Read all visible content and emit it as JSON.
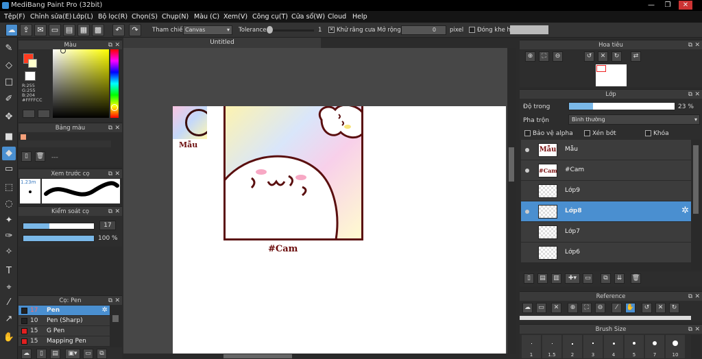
{
  "app": {
    "title": "MediBang Paint Pro (32bit)"
  },
  "window": {
    "min": "—",
    "max": "❐",
    "close": "✕"
  },
  "menu": [
    "Tệp(F)",
    "Chỉnh sửa(E)",
    "Lớp(L)",
    "Bộ lọc(R)",
    "Chọn(S)",
    "Chụp(N)",
    "Màu (C)",
    "Xem(V)",
    "Công cụ(T)",
    "Cửa sổ(W)",
    "Cloud",
    "Help"
  ],
  "toolbar": {
    "ref_label": "Tham chiếu",
    "ref_value": "Canvas",
    "tolerance_label": "Tolerance",
    "tolerance_value": "1",
    "antialias_label": "Khử răng cưa",
    "expand_label": "Mở rộng",
    "expand_value": "0",
    "expand_unit": "pixel",
    "gap_label": "Đóng khe hở"
  },
  "document": {
    "tab": "Untitled"
  },
  "color_panel": {
    "title": "Màu",
    "r": "R:255",
    "g": "G:255",
    "b": "B:204",
    "hex": "#FFFFCC",
    "fg_color": "#ff3b1f",
    "bg_color": "#ffffcc"
  },
  "palette_panel": {
    "title": "Bảng màu",
    "dashes": "---",
    "swatch": "#f4a07a"
  },
  "brush_preview": {
    "title": "Xem trước cọ",
    "size": "1.23m"
  },
  "brush_control": {
    "title": "Kiểm soát cọ",
    "size_value": "17",
    "opacity_value": "100 %",
    "size_fraction": 0.37,
    "opacity_fraction": 1.0
  },
  "brush_panel": {
    "title": "Cọ: Pen",
    "items": [
      {
        "size": "17",
        "name": "Pen",
        "color": "#222222"
      },
      {
        "size": "10",
        "name": "Pen (Sharp)",
        "color": "#222222"
      },
      {
        "size": "15",
        "name": "G Pen",
        "color": "#e02020"
      },
      {
        "size": "15",
        "name": "Mapping Pen",
        "color": "#e02020"
      }
    ]
  },
  "canvas_text": {
    "label_top": "Mẫu",
    "label_bottom": "#Cam"
  },
  "navigator": {
    "title": "Hoa tiêu"
  },
  "layer_panel": {
    "title": "Lớp",
    "opacity_label": "Độ trong",
    "opacity_value": "23 %",
    "opacity_fraction": 0.23,
    "blend_label": "Pha trộn",
    "blend_value": "Bình thường",
    "protect_alpha": "Bảo vệ alpha",
    "clipping": "Xén bớt",
    "lock": "Khóa",
    "layers": [
      {
        "name": "Mẫu",
        "thumb": "Mẫu"
      },
      {
        "name": "#Cam",
        "thumb": "#Cam"
      },
      {
        "name": "Lớp9",
        "thumb": ""
      },
      {
        "name": "Lớp8",
        "thumb": ""
      },
      {
        "name": "Lớp7",
        "thumb": ""
      },
      {
        "name": "Lớp6",
        "thumb": ""
      }
    ]
  },
  "reference_panel": {
    "title": "Reference"
  },
  "brush_size_panel": {
    "title": "Brush Size",
    "sizes": [
      "1",
      "1.5",
      "2",
      "3",
      "4",
      "5",
      "7",
      "10"
    ]
  }
}
